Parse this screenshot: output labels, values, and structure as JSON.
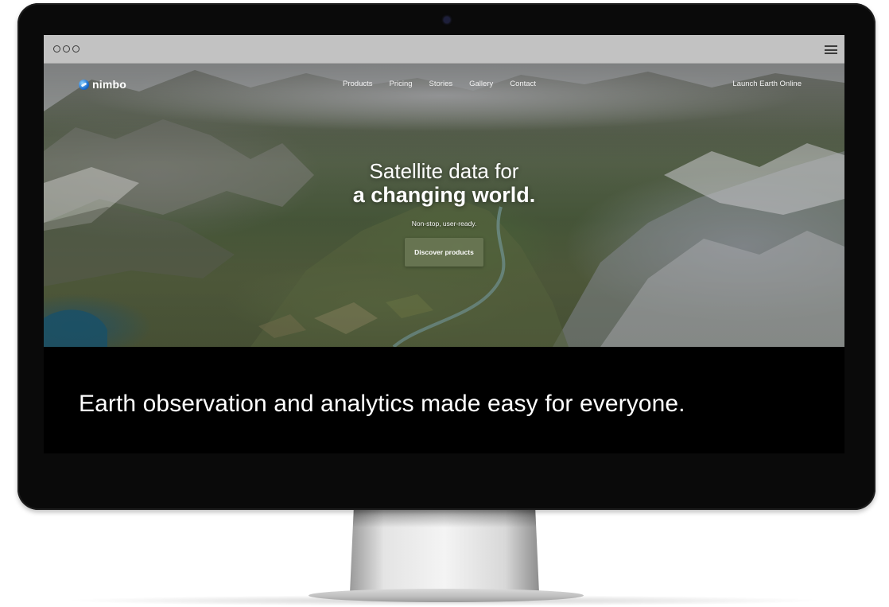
{
  "browser": {
    "window_controls": [
      "circle",
      "circle",
      "circle"
    ],
    "menu_icon": "hamburger-icon"
  },
  "nav": {
    "logo_text": "nimbo",
    "logo_icon": "globe-logo-icon",
    "links": [
      {
        "label": "Products"
      },
      {
        "label": "Pricing"
      },
      {
        "label": "Stories"
      },
      {
        "label": "Gallery"
      },
      {
        "label": "Contact"
      }
    ],
    "cta_label": "Launch Earth Online"
  },
  "hero": {
    "title_line1": "Satellite data for",
    "title_line2": "a changing world.",
    "subtitle": "Non-stop, user-ready.",
    "button_label": "Discover products",
    "button_color": "#697654"
  },
  "tagline": {
    "text": "Earth observation and analytics made easy for everyone."
  }
}
